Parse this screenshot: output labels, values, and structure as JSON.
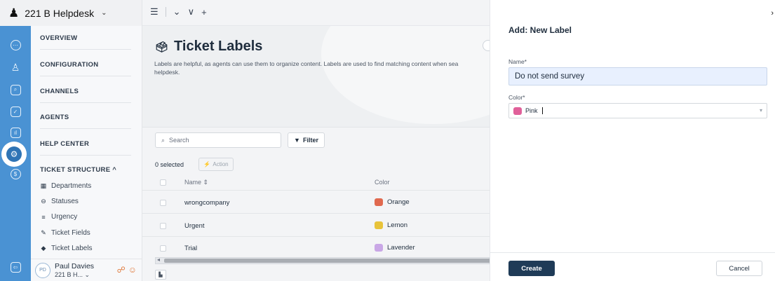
{
  "brand": {
    "name": "221 B Helpdesk",
    "caret": "⌄",
    "logo": "person-icon"
  },
  "toolbar": {
    "list_icon": "☰",
    "caret": "⌄",
    "chevron": "∨",
    "plus": "+"
  },
  "sidebar": {
    "sections": [
      {
        "label": "OVERVIEW"
      },
      {
        "label": "CONFIGURATION"
      },
      {
        "label": "CHANNELS"
      },
      {
        "label": "AGENTS"
      },
      {
        "label": "HELP CENTER"
      },
      {
        "label": "TICKET STRUCTURE ^"
      }
    ],
    "items": [
      {
        "label": "Departments",
        "icon": "grid-icon"
      },
      {
        "label": "Statuses",
        "icon": "circle-icon"
      },
      {
        "label": "Urgency",
        "icon": "sort-icon"
      },
      {
        "label": "Ticket Fields",
        "icon": "edit-icon"
      },
      {
        "label": "Ticket Labels",
        "icon": "tag-icon"
      }
    ],
    "user": {
      "initials": "PD",
      "name": "Paul Davies",
      "org": "221 B H... ⌄"
    }
  },
  "main": {
    "title": "Ticket Labels",
    "description": "Labels are helpful, as agents can use them to organize content. Labels are used to find matching content when sea",
    "description2": "helpdesk.",
    "search_placeholder": "Search",
    "filter_label": "Filter",
    "selected_text": "0 selected",
    "action_label": "Action",
    "columns": {
      "name": "Name ⇕",
      "color": "Color"
    },
    "rows": [
      {
        "name": "wrongcompany",
        "color": "Orange",
        "hex": "#e0694f"
      },
      {
        "name": "Urgent",
        "color": "Lemon",
        "hex": "#e8c33a"
      },
      {
        "name": "Trial",
        "color": "Lavender",
        "hex": "#c9a7e6"
      }
    ]
  },
  "drawer": {
    "title": "Add: New Label",
    "close": "›",
    "name_label": "Name*",
    "name_value": "Do not send survey",
    "color_label": "Color*",
    "color_value": "Pink",
    "color_hex": "#e0609a",
    "create_label": "Create",
    "cancel_label": "Cancel"
  },
  "colors": {
    "rail": "#4a92d3",
    "primary_button": "#1f3b57"
  }
}
